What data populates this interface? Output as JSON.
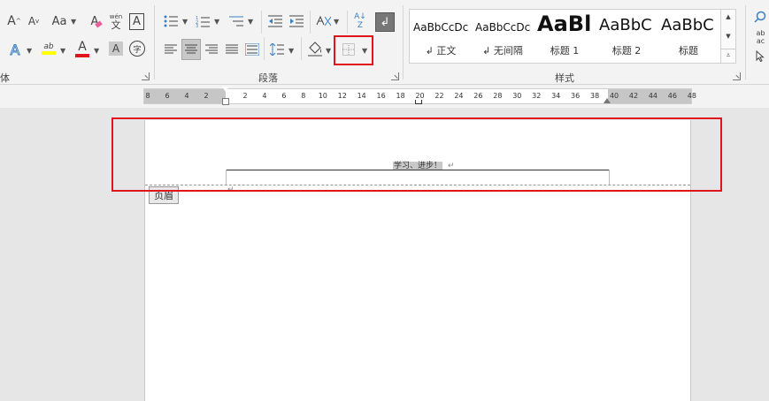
{
  "ribbon": {
    "font_group": {
      "label": "体",
      "grow_font": "A",
      "shrink_font": "A",
      "change_case": "Aa",
      "clear_format": "A",
      "phonetic_top": "wén",
      "phonetic_bottom": "文",
      "char_border": "A",
      "text_effect": "A",
      "highlight": "ab",
      "font_color": "A",
      "char_shading": "A",
      "enclose": "字",
      "highlight_color": "#ffff00",
      "font_color_value": "#e0141a"
    },
    "paragraph_group": {
      "label": "段落"
    },
    "styles_group": {
      "label": "样式",
      "items": [
        {
          "sample": "AaBbCcDc",
          "name": "↲ 正文"
        },
        {
          "sample": "AaBbCcDc",
          "name": "↲ 无间隔"
        },
        {
          "sample": "AaBl",
          "name": "标题 1"
        },
        {
          "sample": "AaBbC",
          "name": "标题 2"
        },
        {
          "sample": "AaBbC",
          "name": "标题"
        }
      ]
    },
    "editing": {
      "sort_label": "A↓Z",
      "replace_top": "ab",
      "replace_bottom": "ac"
    }
  },
  "ruler": {
    "left_ticks": [
      "8",
      "6",
      "4",
      "2"
    ],
    "right_ticks": [
      "2",
      "4",
      "6",
      "8",
      "10",
      "12",
      "14",
      "16",
      "18",
      "20",
      "22",
      "24",
      "26",
      "28",
      "30",
      "32",
      "34",
      "36",
      "38",
      "40",
      "42",
      "44",
      "46",
      "48"
    ]
  },
  "document": {
    "header_text": "学习、进步！",
    "paragraph_mark": "↵",
    "header_tag": "页眉"
  },
  "highlight_color": "#e0141a"
}
